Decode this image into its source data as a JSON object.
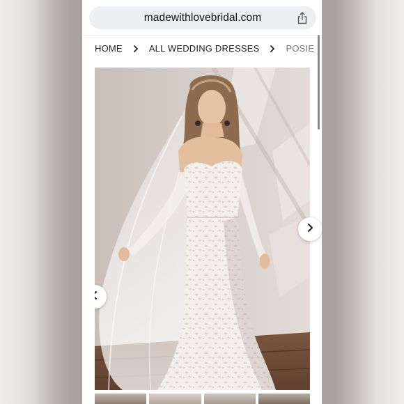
{
  "browser": {
    "url": "madewithlovebridal.com",
    "share_icon": "share-icon"
  },
  "breadcrumb": {
    "items": [
      {
        "label": "HOME"
      },
      {
        "label": "ALL WEDDING DRESSES"
      },
      {
        "label": "POSIE"
      }
    ],
    "separator_icon": "chevron-right-icon"
  },
  "gallery": {
    "prev_icon": "chevron-left-icon",
    "next_icon": "chevron-right-icon",
    "thumbnail_count": 4
  },
  "colors": {
    "page_background": "#ffffff",
    "url_bar": "#eeeff0",
    "wall": "#d6cec8",
    "floor": "#6b4a36"
  }
}
